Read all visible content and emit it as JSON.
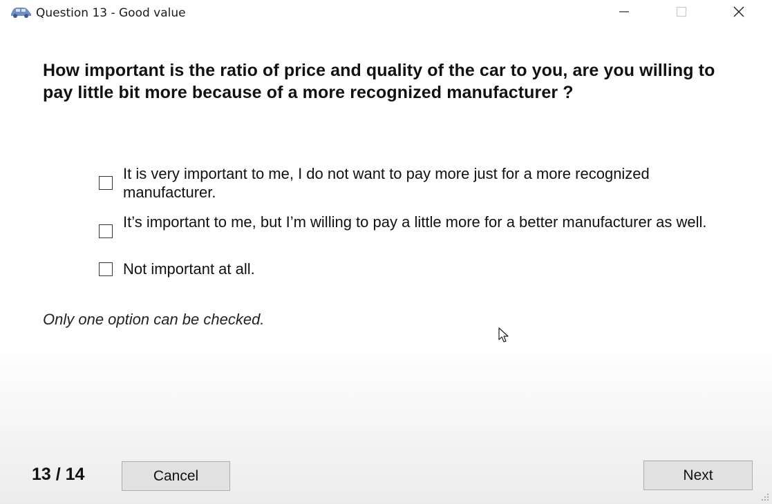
{
  "window": {
    "title": "Question 13 - Good value",
    "app_icon": "car-icon"
  },
  "question": {
    "text": "How important is the ratio of price and quality of the car to you, are you willing to pay little bit more because of a more recognized manufacturer ?",
    "options": [
      {
        "label": "It is very important to me, I do not want to pay more just for a more recognized manufacturer.",
        "checked": false
      },
      {
        "label": "It’s important to me, but I’m willing to pay a little more for a better manufacturer as well.",
        "checked": false
      },
      {
        "label": "Not important at all.",
        "checked": false
      }
    ],
    "hint": "Only one option can be checked."
  },
  "footer": {
    "counter": "13 / 14",
    "cancel_label": "Cancel",
    "next_label": "Next"
  }
}
